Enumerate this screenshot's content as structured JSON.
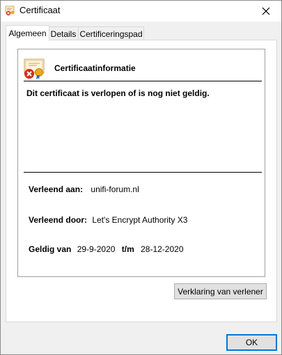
{
  "window": {
    "title": "Certificaat",
    "icons": {
      "title": "certificate-error-icon",
      "close": "close-icon"
    }
  },
  "tabs": [
    {
      "label": "Algemeen",
      "active": true
    },
    {
      "label": "Details",
      "active": false
    },
    {
      "label": "Certificeringspad",
      "active": false
    }
  ],
  "general": {
    "heading": "Certificaatinformatie",
    "cert_icon": "certificate-error-icon",
    "warning": "Dit certificaat is verlopen of is nog niet geldig.",
    "issued_to_label": "Verleend aan:",
    "issued_to_value": "unifi-forum.nl",
    "issued_by_label": "Verleend door:",
    "issued_by_value": "Let's Encrypt Authority X3",
    "valid_from_label": "Geldig van",
    "valid_from_value": "29-9-2020",
    "valid_to_label": "t/m",
    "valid_to_value": "28-12-2020"
  },
  "buttons": {
    "issuer_statement": "Verklaring van verlener",
    "ok": "OK"
  },
  "colors": {
    "error_red": "#d52b1e",
    "seal_gold": "#e8a920",
    "focus_blue": "#0078d7"
  }
}
